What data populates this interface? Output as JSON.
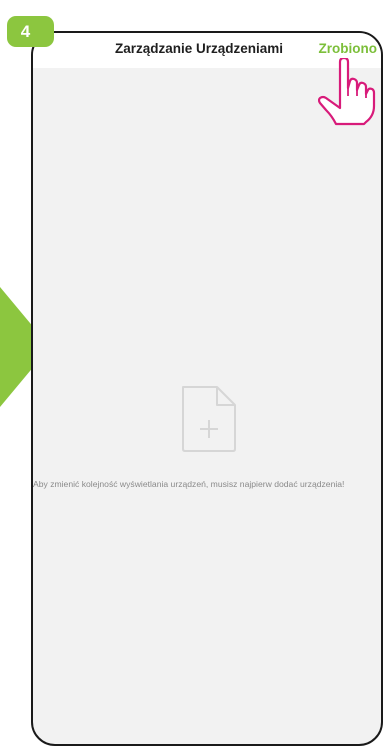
{
  "step": {
    "number": "4"
  },
  "header": {
    "title": "Zarządzanie Urządzeniami",
    "done_label": "Zrobiono"
  },
  "empty_state": {
    "icon": "add-file-icon",
    "message": "Aby zmienić kolejność wyświetlania urządzeń, musisz najpierw dodać urządzenia!"
  },
  "decorations": {
    "arrow_icon": "arrow-right-icon",
    "pointer_icon": "hand-pointer-icon"
  },
  "colors": {
    "accent_green": "#8cc63f",
    "done_green": "#7cbf3a",
    "hand_pink": "#d81b7a",
    "screen_background": "#f2f2f2"
  }
}
